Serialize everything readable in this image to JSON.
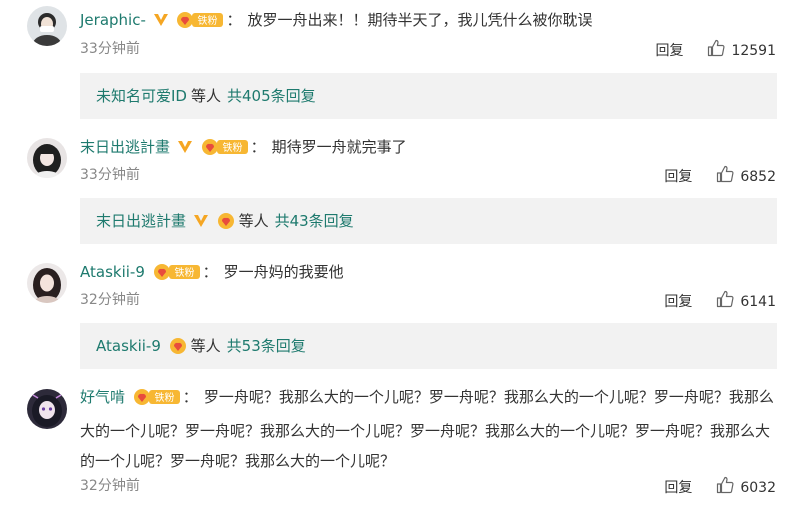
{
  "comments": [
    {
      "username": "Jeraphic-",
      "has_v": true,
      "fan_badge": "铁粉",
      "text": "放罗一舟出来！！期待半天了，我儿凭什么被你耽误",
      "time": "33分钟前",
      "reply_label": "回复",
      "likes": "12591",
      "replies": {
        "username": "未知名可爱ID",
        "etc": "等人",
        "count_text": "共405条回复"
      }
    },
    {
      "username": "末日出逃計畫",
      "has_v": true,
      "fan_badge": "铁粉",
      "text": "期待罗一舟就完事了",
      "time": "33分钟前",
      "reply_label": "回复",
      "likes": "6852",
      "replies": {
        "username": "末日出逃計畫",
        "etc": "等人",
        "count_text": "共43条回复"
      }
    },
    {
      "username": "Ataskii-9",
      "has_v": false,
      "fan_badge": "铁粉",
      "text": "罗一舟妈的我要他",
      "time": "32分钟前",
      "reply_label": "回复",
      "likes": "6141",
      "replies": {
        "username": "Ataskii-9",
        "etc": "等人",
        "count_text": "共53条回复"
      }
    },
    {
      "username": "好气啃",
      "has_v": false,
      "fan_badge": "铁粉",
      "text": "罗一舟呢？我那么大的一个儿呢？罗一舟呢？我那么大的一个儿呢？罗一舟呢？我那么大的一个儿呢？罗一舟呢？我那么大的一个儿呢？罗一舟呢？我那么大的一个儿呢？罗一舟呢？我那么大的一个儿呢？罗一舟呢？我那么大的一个儿呢？",
      "time": "32分钟前",
      "reply_label": "回复",
      "likes": "6032"
    }
  ],
  "colors": {
    "username": "#1e7a6e",
    "v_badge": "#f5a623",
    "fan_badge": "#f7b733",
    "reply_box_bg": "#f2f2f2",
    "time": "#888888"
  },
  "icons": [
    "avatar",
    "v-verified-icon",
    "fan-badge-icon",
    "like-icon"
  ]
}
